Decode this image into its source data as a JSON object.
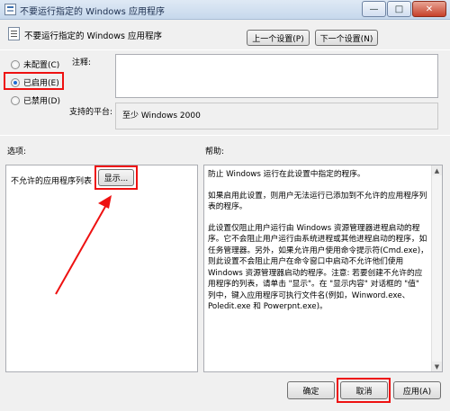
{
  "window": {
    "title": "不要运行指定的 Windows 应用程序",
    "minimize_glyph": "—",
    "maximize_glyph": "□",
    "close_glyph": "✕"
  },
  "header": {
    "policy_title": "不要运行指定的 Windows 应用程序",
    "prev_button": "上一个设置(P)",
    "next_button": "下一个设置(N)"
  },
  "state": {
    "options": [
      {
        "label": "未配置(C)",
        "selected": false
      },
      {
        "label": "已启用(E)",
        "selected": true
      },
      {
        "label": "已禁用(D)",
        "selected": false
      }
    ]
  },
  "comment": {
    "label": "注释:",
    "value": ""
  },
  "platform": {
    "label": "支持的平台:",
    "value": "至少 Windows 2000"
  },
  "options_pane": {
    "label": "选项:",
    "row_label": "不允许的应用程序列表",
    "show_button": "显示..."
  },
  "help_pane": {
    "label": "帮助:",
    "paragraphs": [
      "防止 Windows 运行在此设置中指定的程序。",
      "如果启用此设置，则用户无法运行已添加到不允许的应用程序列表的程序。",
      "此设置仅阻止用户运行由 Windows 资源管理器进程启动的程序。它不会阻止用户运行由系统进程或其他进程启动的程序，如任务管理器。另外，如果允许用户使用命令提示符(Cmd.exe)，则此设置不会阻止用户在命令窗口中启动不允许他们使用 Windows 资源管理器启动的程序。注意: 若要创建不允许的应用程序的列表，请单击 \"显示\"。在 \"显示内容\" 对话框的 \"值\" 列中，键入应用程序可执行文件名(例如，Winword.exe、Poledit.exe 和 Powerpnt.exe)。"
    ]
  },
  "footer": {
    "ok_button": "确定",
    "cancel_button": "取消",
    "apply_button": "应用(A)"
  },
  "annotation": {
    "highlight_color": "#ee1111"
  }
}
